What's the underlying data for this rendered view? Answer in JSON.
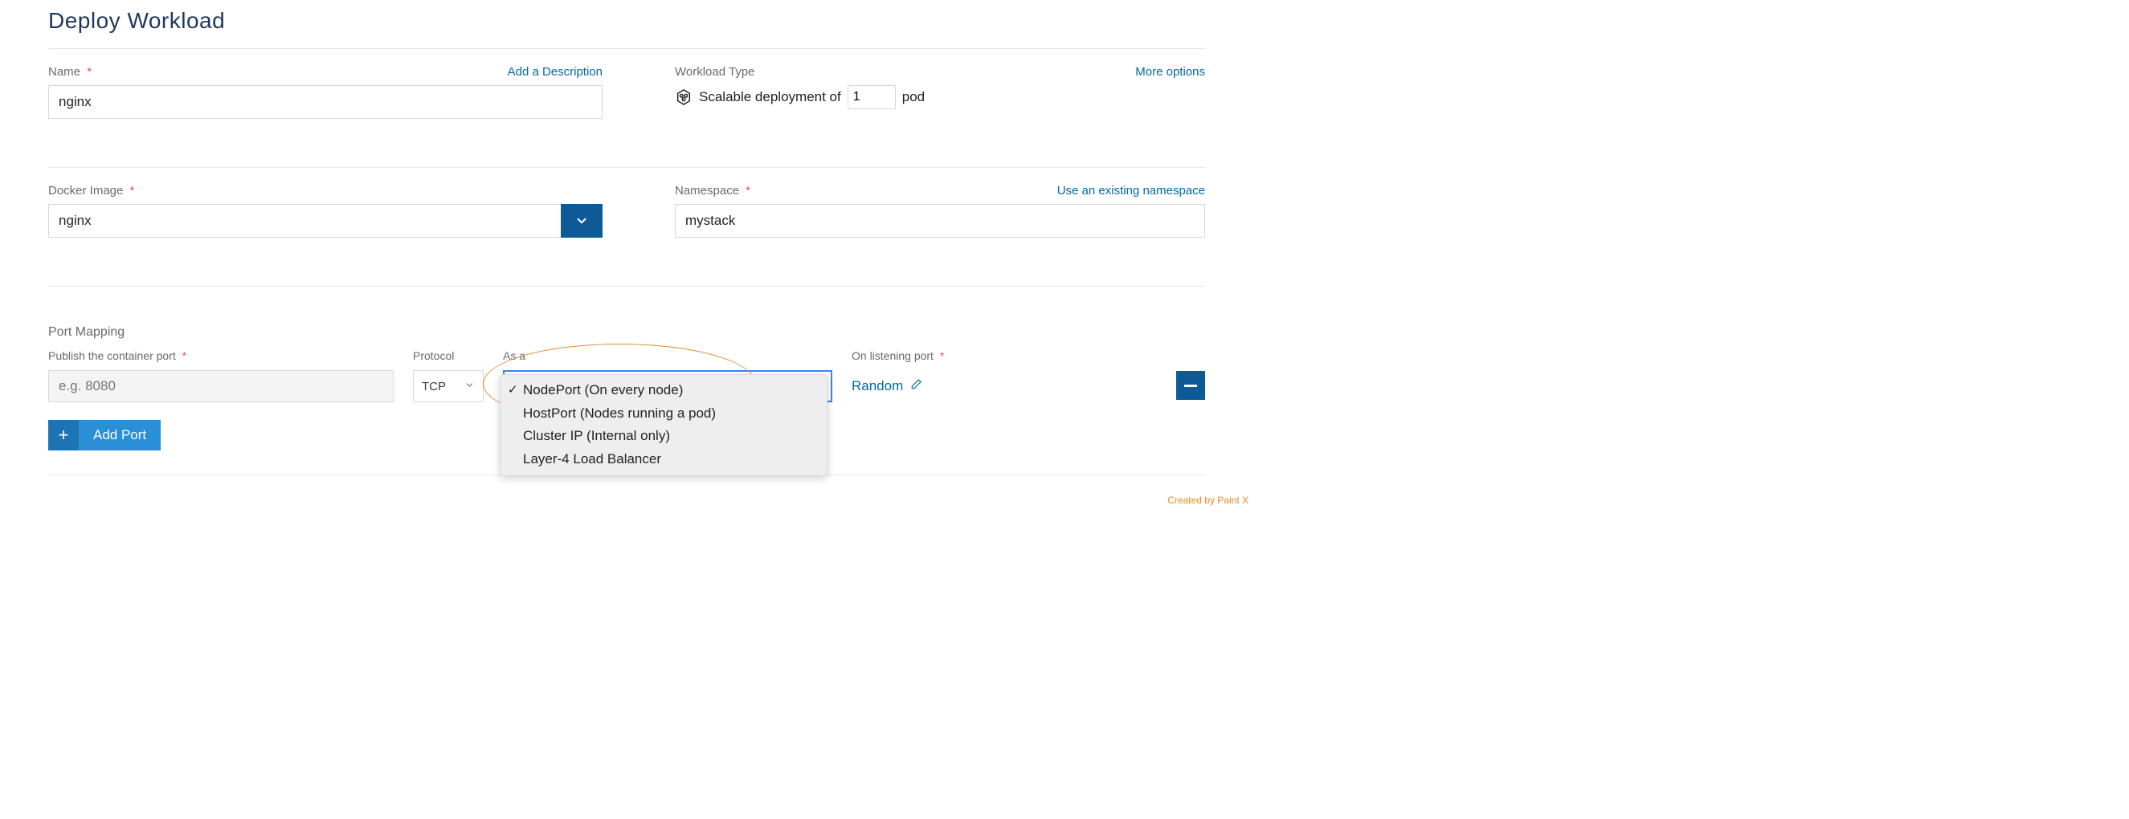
{
  "title": "Deploy Workload",
  "name_section": {
    "label": "Name",
    "link": "Add a Description",
    "value": "nginx"
  },
  "workload_type": {
    "label": "Workload Type",
    "link": "More options",
    "text_before": "Scalable deployment of",
    "pod_count": "1",
    "text_after": "pod"
  },
  "docker_image": {
    "label": "Docker Image",
    "value": "nginx"
  },
  "namespace": {
    "label": "Namespace",
    "link": "Use an existing namespace",
    "value": "mystack"
  },
  "port_mapping": {
    "heading": "Port Mapping",
    "publish_label": "Publish the container port",
    "publish_placeholder": "e.g. 8080",
    "protocol_label": "Protocol",
    "protocol_value": "TCP",
    "asa_label": "As a",
    "asa_options": [
      "NodePort (On every node)",
      "HostPort (Nodes running a pod)",
      "Cluster IP (Internal only)",
      "Layer-4 Load Balancer"
    ],
    "asa_selected_index": 0,
    "listening_label": "On listening port",
    "listening_value": "Random",
    "add_button": "Add Port"
  },
  "watermark": "Created by Paint X"
}
